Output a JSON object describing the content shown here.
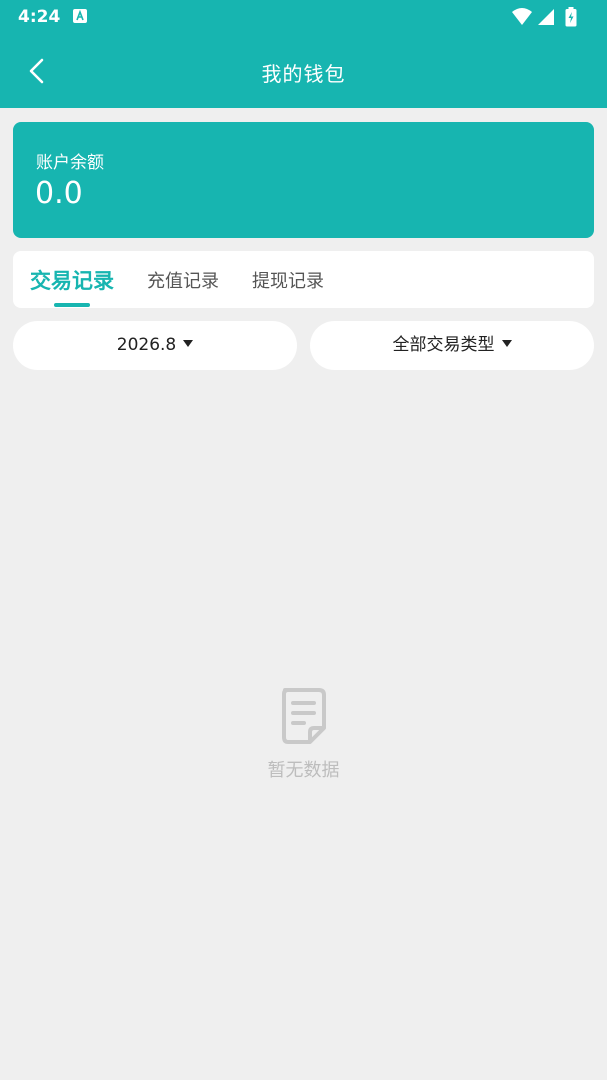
{
  "status_bar": {
    "time": "4:24"
  },
  "nav": {
    "title": "我的钱包"
  },
  "balance": {
    "label": "账户余额",
    "value": "0.0"
  },
  "tabs": [
    {
      "label": "交易记录",
      "active": true
    },
    {
      "label": "充值记录",
      "active": false
    },
    {
      "label": "提现记录",
      "active": false
    }
  ],
  "filters": {
    "month": "2026.8",
    "type": "全部交易类型"
  },
  "empty": {
    "text": "暂无数据"
  },
  "colors": {
    "accent": "#17b5b0",
    "background": "#efefef"
  }
}
